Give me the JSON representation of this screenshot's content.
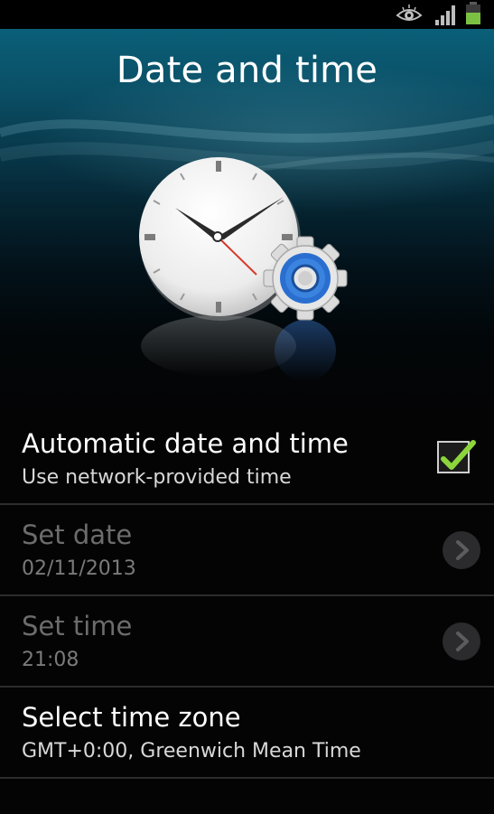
{
  "status_bar": {
    "icons": [
      "eye-icon",
      "signal-icon",
      "battery-icon"
    ]
  },
  "header": {
    "title": "Date and time",
    "illustration": "clock-with-gear"
  },
  "settings": {
    "automatic": {
      "title": "Automatic date and time",
      "subtitle": "Use network-provided time",
      "checked": true
    },
    "set_date": {
      "title": "Set date",
      "subtitle": "02/11/2013",
      "enabled": false
    },
    "set_time": {
      "title": "Set time",
      "subtitle": "21:08",
      "enabled": false
    },
    "time_zone": {
      "title": "Select time zone",
      "subtitle": "GMT+0:00, Greenwich Mean Time"
    }
  },
  "colors": {
    "accent_check": "#8cd63c",
    "gear_blue": "#2a6fd0",
    "battery_green": "#7bc043"
  }
}
